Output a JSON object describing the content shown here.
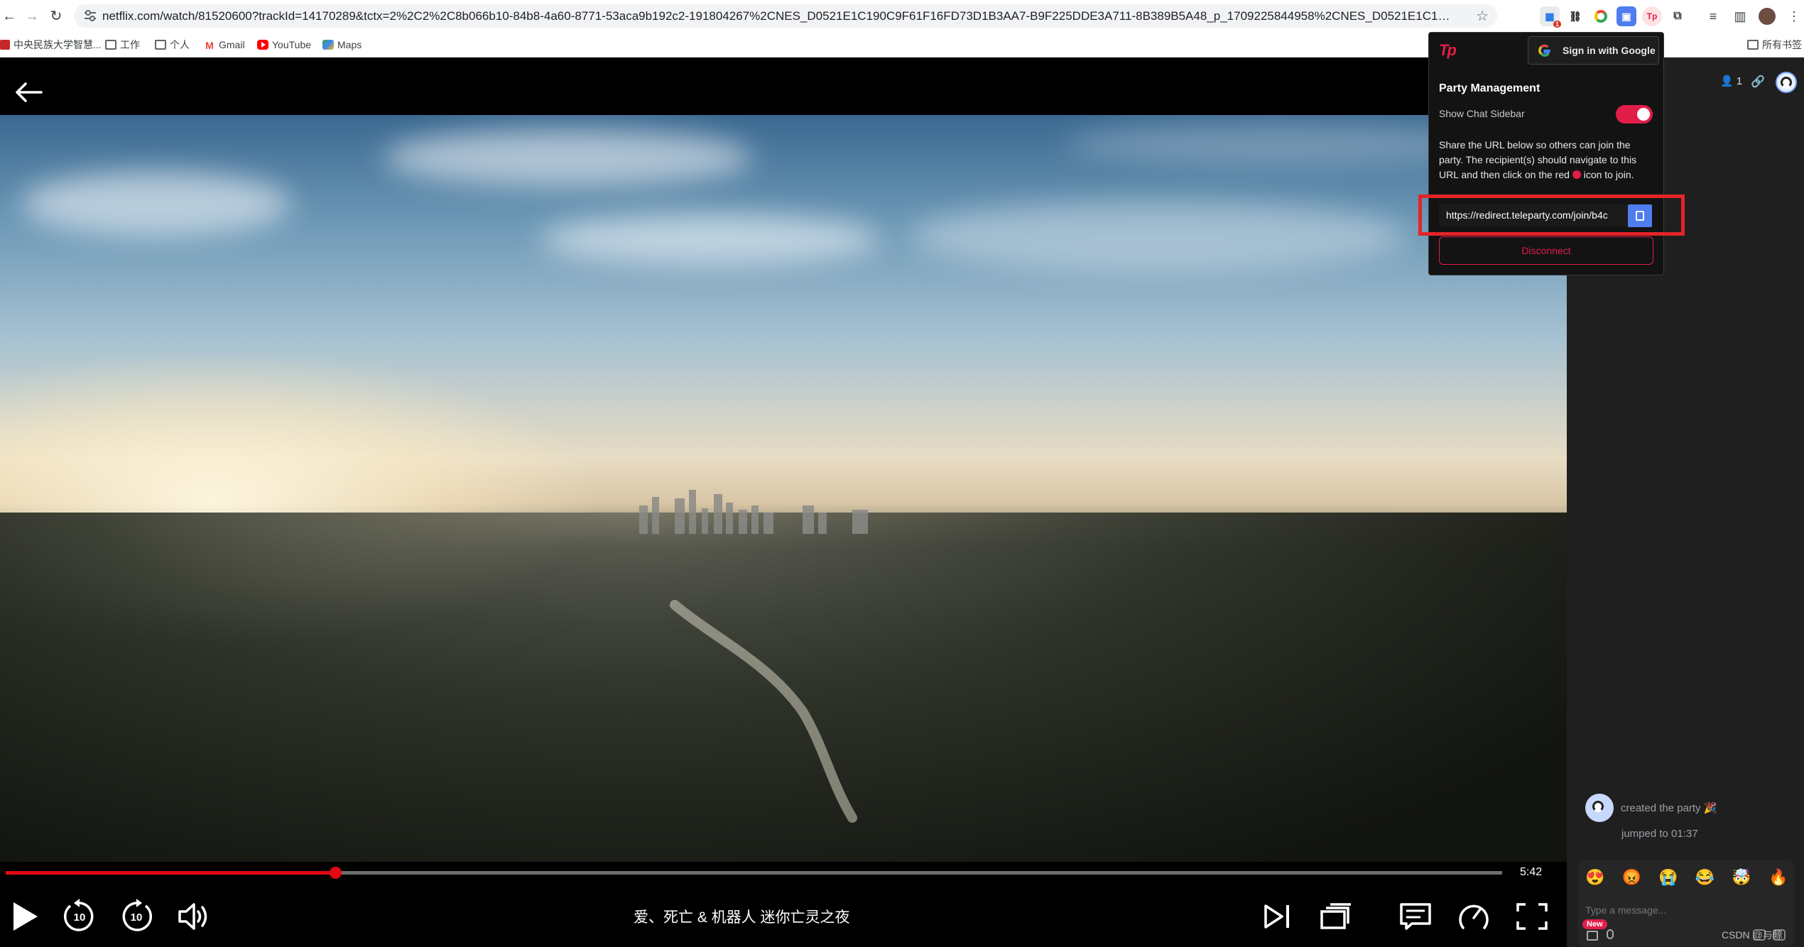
{
  "browser": {
    "url": "netflix.com/watch/81520600?trackId=14170289&tctx=2%2C2%2C8b066b10-84b8-4a60-8771-53aca9b192c2-191804267%2CNES_D0521E1C190C9F61F16FD73D1B3AA7-B9F225DDE3A711-8B389B5A48_p_1709225844958%2CNES_D0521E1C190C9F61F16FD73D1B3AA7_p_1709225844958%2C...",
    "bookmarks": [
      {
        "label": "中央民族大学智慧..."
      },
      {
        "label": "工作"
      },
      {
        "label": "个人"
      },
      {
        "label": "Gmail"
      },
      {
        "label": "YouTube"
      },
      {
        "label": "Maps"
      }
    ],
    "all_bookmarks_label": "所有书签",
    "extension_badge": "1"
  },
  "player": {
    "progress_fraction": 0.22,
    "time_remaining": "5:42",
    "title": "爱、死亡 & 机器人 迷你亡灵之夜",
    "skip_back": "10",
    "skip_forward": "10"
  },
  "popup": {
    "logo": "Tp",
    "google_signin_label": "Sign in with Google",
    "party_management_title": "Party Management",
    "show_chat_label": "Show Chat Sidebar",
    "show_chat_enabled": true,
    "share_text_1": "Share the URL below so others can join the party. The recipient(s) should navigate to this URL and then click on the red",
    "share_text_2": "icon to join.",
    "share_url": "https://redirect.teleparty.com/join/b4c",
    "disconnect_label": "Disconnect"
  },
  "sidebar": {
    "user_count": "1",
    "messages": [
      {
        "text": "created the party",
        "emoji": "🎉"
      },
      {
        "text": "jumped to 01:37"
      }
    ],
    "emoji_reactions": [
      "😍",
      "😡",
      "😭",
      "😂",
      "🤯",
      "🔥"
    ],
    "chat_placeholder": "Type a message...",
    "new_badge": "New"
  },
  "watermark": "CSDN @与鲸"
}
